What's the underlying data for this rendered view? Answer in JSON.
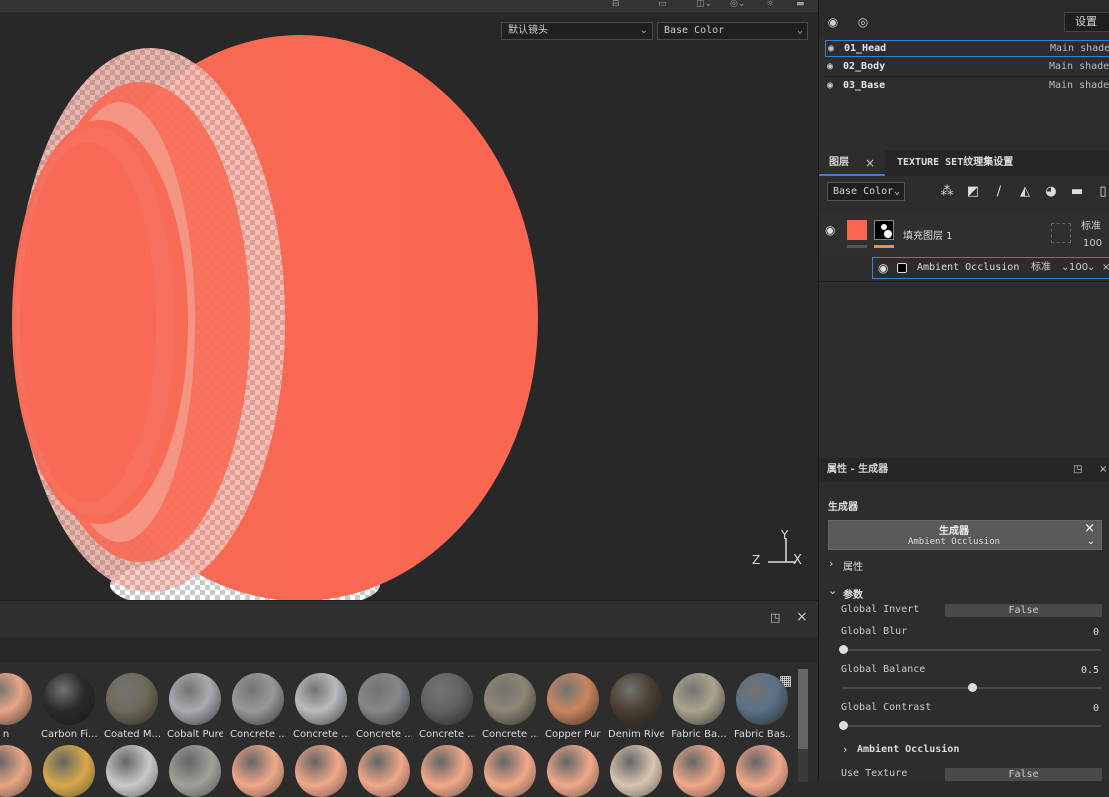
{
  "viewport": {
    "camera_select": "默认镜头",
    "channel_select": "Base Color",
    "axis_labels": {
      "y": "Y",
      "z": "Z",
      "x": "X"
    }
  },
  "texture_sets": {
    "settings_label": "设置",
    "rows": [
      {
        "name": "01_Head",
        "shader": "Main shader"
      },
      {
        "name": "02_Body",
        "shader": "Main shader"
      },
      {
        "name": "03_Base",
        "shader": "Main shader"
      }
    ]
  },
  "layers": {
    "tab_layers": "图层",
    "tab_texture_settings": "TEXTURE SET纹理集设置",
    "channel": "Base Color",
    "fill_layer": {
      "name": "填充图层 1",
      "blend": "标准",
      "opacity": "100"
    },
    "effect": {
      "name": "Ambient Occlusion",
      "blend": "标准",
      "opacity": "100"
    }
  },
  "properties": {
    "header": "属性 - 生成器",
    "section_title": "生成器",
    "generator_title": "生成器",
    "generator_name": "Ambient Occlusion",
    "attr_group": "属性",
    "params_group": "参数",
    "global_invert_label": "Global Invert",
    "global_invert_value": "False",
    "global_blur_label": "Global Blur",
    "global_blur_value": "0",
    "global_blur_level": 0,
    "global_balance_label": "Global Balance",
    "global_balance_value": "0.5",
    "global_balance_level": 0.5,
    "global_contrast_label": "Global Contrast",
    "global_contrast_value": "0",
    "global_contrast_level": 0,
    "ao_group": "Ambient Occlusion",
    "use_texture_label": "Use Texture",
    "use_texture_value": "False"
  },
  "shelf": {
    "materials": [
      {
        "label": "n",
        "color": "#e8a585"
      },
      {
        "label": "Carbon Fi...",
        "color": "#2a2a2a"
      },
      {
        "label": "Coated M...",
        "color": "#6e6a58"
      },
      {
        "label": "Cobalt Pure",
        "color": "#a9abb0"
      },
      {
        "label": "Concrete ...",
        "color": "#9a9995"
      },
      {
        "label": "Concrete ...",
        "color": "#b8bcbf"
      },
      {
        "label": "Concrete ...",
        "color": "#84888b"
      },
      {
        "label": "Concrete ...",
        "color": "#5f6264"
      },
      {
        "label": "Concrete ...",
        "color": "#8d8674"
      },
      {
        "label": "Copper Pure",
        "color": "#c98660"
      },
      {
        "label": "Denim Rivet",
        "color": "#4a3f30"
      },
      {
        "label": "Fabric Ba...",
        "color": "#a9a48e"
      },
      {
        "label": "Fabric Bas...",
        "color": "#5a7186"
      }
    ]
  }
}
